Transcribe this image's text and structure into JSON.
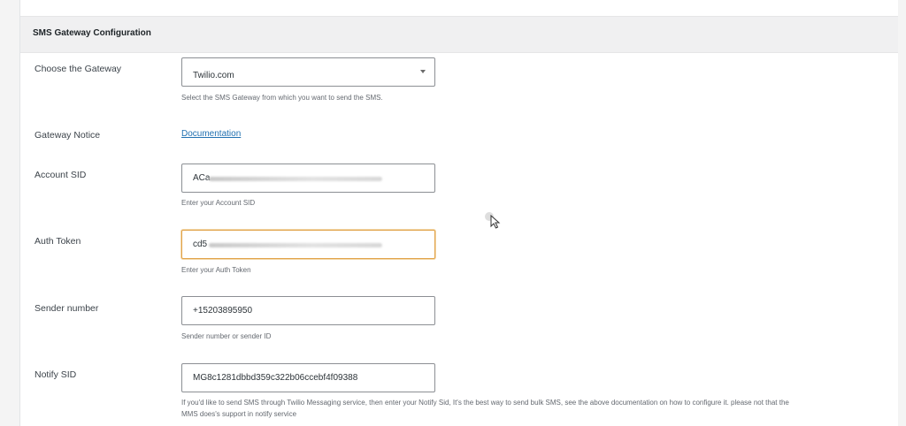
{
  "header": {
    "title": "SMS Gateway Configuration"
  },
  "gateway": {
    "label": "Choose the Gateway",
    "selected": "Twilio.com",
    "help": "Select the SMS Gateway from which you want to send the SMS."
  },
  "notice": {
    "label": "Gateway Notice",
    "link_text": "Documentation"
  },
  "account_sid": {
    "label": "Account SID",
    "value": "ACa",
    "help": "Enter your Account SID"
  },
  "auth_token": {
    "label": "Auth Token",
    "value": "cd5",
    "help": "Enter your Auth Token"
  },
  "sender": {
    "label": "Sender number",
    "value": "+15203895950",
    "help": "Sender number or sender ID"
  },
  "notify": {
    "label": "Notify SID",
    "value": "MG8c1281dbbd359c322b06ccebf4f09388",
    "help_line1": "If you'd like to send SMS through Twilio Messaging service, then enter your Notify Sid, It's the best way to send bulk SMS, see the above documentation on how to configure it. please not that the",
    "help_line2": "MMS does's support in notify service"
  },
  "colors": {
    "link": "#2271b1",
    "focus_border": "#e1a34a",
    "header_bg": "#f0f0f1"
  },
  "icons": [
    "chevron-down-icon",
    "mouse-pointer-icon"
  ]
}
